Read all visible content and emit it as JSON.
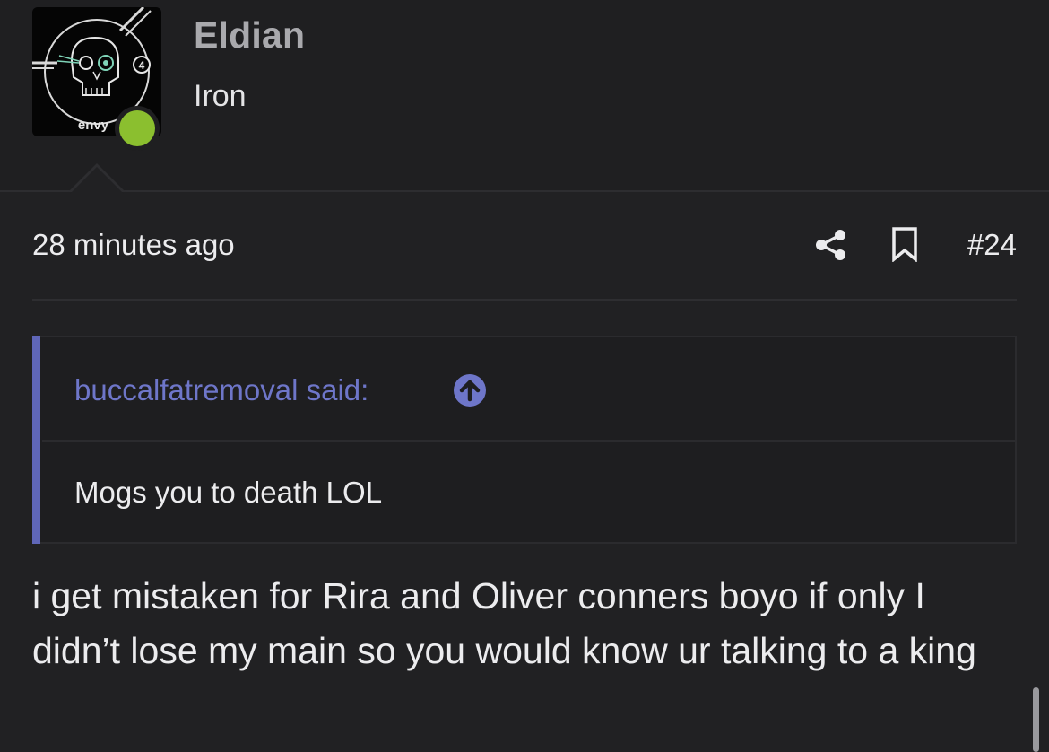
{
  "user": {
    "name": "Eldian",
    "title": "Iron",
    "avatar_badge_text": "envy",
    "avatar_count": "4",
    "status_color": "#8bbf2f",
    "avatar_icon": "skull-icon"
  },
  "meta": {
    "timestamp": "28 minutes ago",
    "post_number": "#24",
    "share_icon": "share-icon",
    "bookmark_icon": "bookmark-icon"
  },
  "quote": {
    "author": "buccalfatremoval said:",
    "jump_icon": "arrow-up-circle-icon",
    "text": "Mogs you to death LOL",
    "accent_color": "#5f66b8"
  },
  "message": {
    "text": "i get mistaken for Rira and Oliver conners boyo if only I didn’t lose my main so you would know ur talking to a king"
  }
}
